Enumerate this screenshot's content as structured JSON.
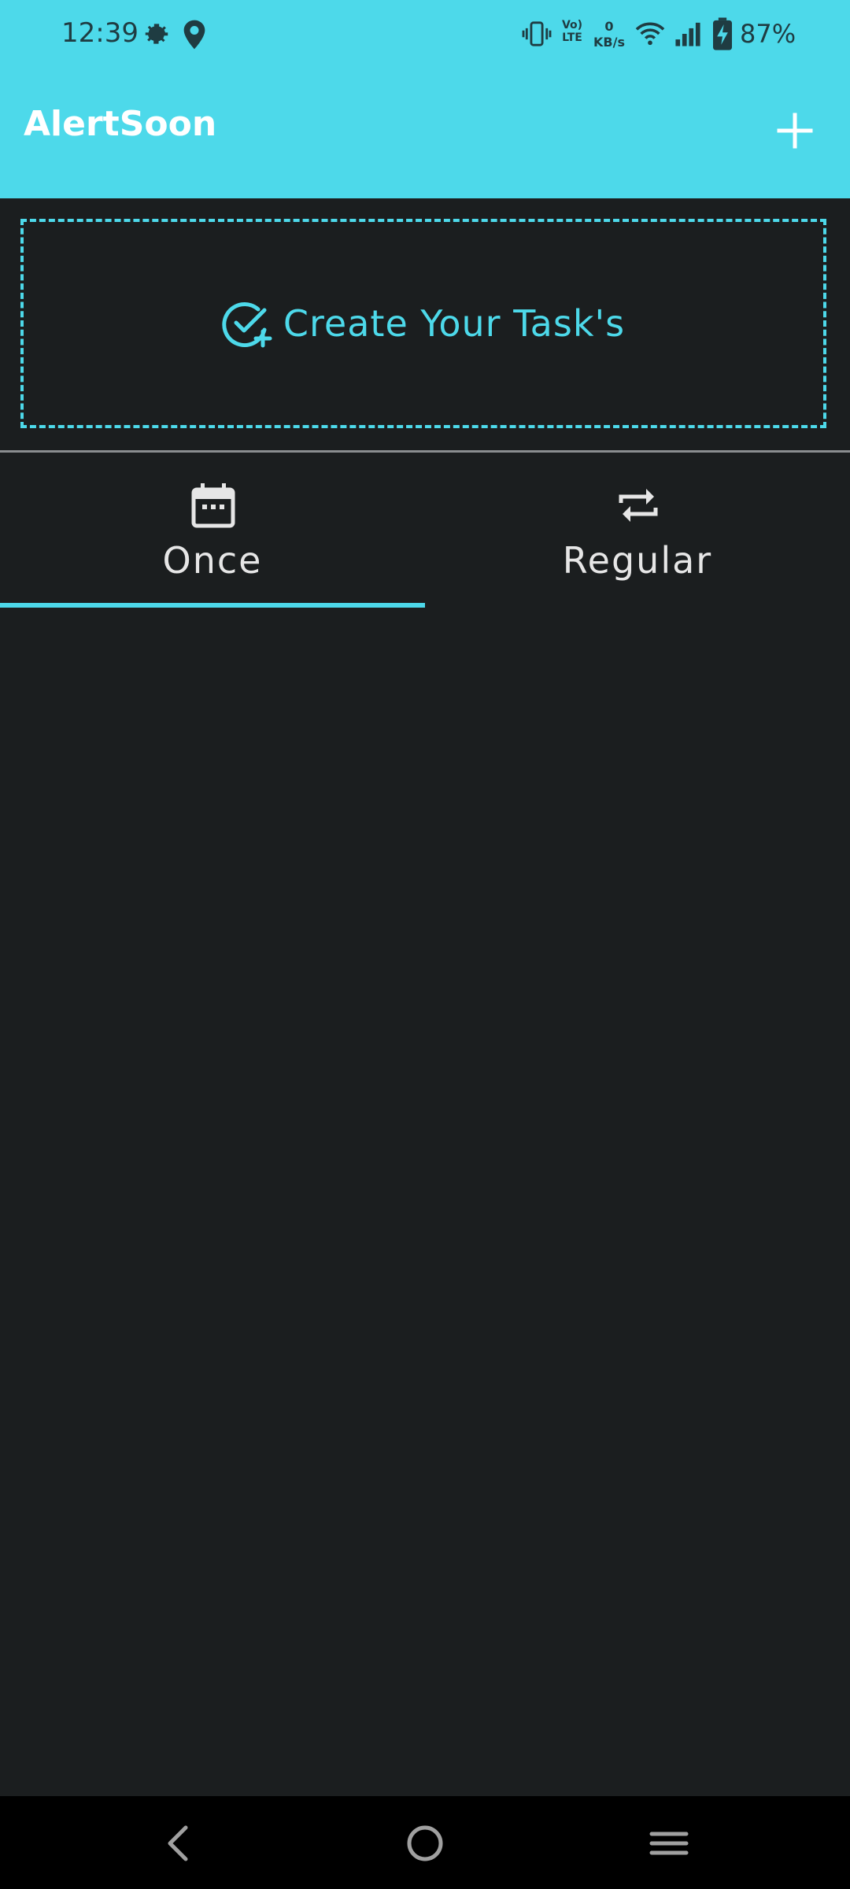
{
  "status_bar": {
    "time": "12:39",
    "volte_line1": "Vo)",
    "volte_line2": "LTE",
    "speed_value": "0",
    "speed_unit": "KB/s",
    "battery": "87%"
  },
  "app_bar": {
    "title": "AlertSoon"
  },
  "create_card": {
    "label": "Create Your Task's"
  },
  "tabs": [
    {
      "label": "Once",
      "icon": "calendar-icon",
      "selected": true
    },
    {
      "label": "Regular",
      "icon": "repeat-icon",
      "selected": false
    }
  ],
  "colors": {
    "accent": "#4dd9ea",
    "background": "#1b1e1f",
    "nav_bar": "#000000"
  }
}
